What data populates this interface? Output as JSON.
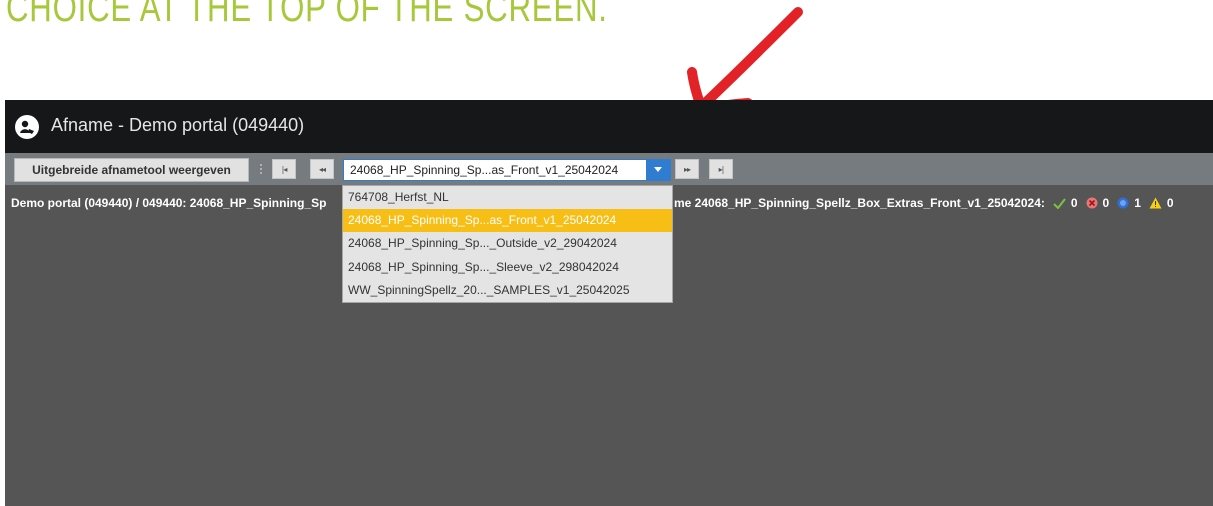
{
  "instruction": {
    "text": "CHOICE AT THE TOP OF THE SCREEN.",
    "color": "#a6c83a"
  },
  "arrow": {
    "color": "#e22226"
  },
  "titlebar": {
    "title": "Afname - Demo portal (049440)",
    "logo_icon": "user-hand-icon"
  },
  "toolbar": {
    "expand_label": "Uitgebreide afnametool weergeven",
    "first_icon": "▸|",
    "nav": {
      "first": "|◂",
      "prev": "◂◂",
      "next": "▸▸",
      "last": "▸|"
    },
    "combo_value": "24068_HP_Spinning_Sp...as_Front_v1_25042024",
    "accent": "#2f7dd1"
  },
  "breadcrumb": {
    "left": "Demo portal (049440) / 049440: 24068_HP_Spinning_Sp",
    "right_prefix": "me 24068_HP_Spinning_Spellz_Box_Extras_Front_v1_25042024:",
    "stats": {
      "ok": "0",
      "error": "0",
      "info": "1",
      "warning": "0"
    }
  },
  "dropdown": {
    "options": [
      "764708_Herfst_NL",
      "24068_HP_Spinning_Sp...as_Front_v1_25042024",
      "24068_HP_Spinning_Sp..._Outside_v2_29042024",
      "24068_HP_Spinning_Sp..._Sleeve_v2_298042024",
      "WW_SpinningSpellz_20..._SAMPLES_v1_25042025"
    ],
    "selected_index": 1,
    "highlight_color": "#f7bf16"
  }
}
